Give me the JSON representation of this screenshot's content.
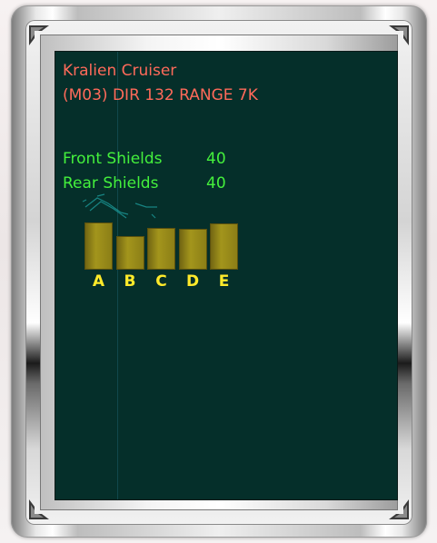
{
  "target": {
    "name": "Kralien Cruiser",
    "info": "(M03) DIR 132 RANGE 7K"
  },
  "shields": {
    "front_label": "Front Shields",
    "front_value": "40",
    "rear_label": "Rear Shields",
    "rear_value": "40"
  },
  "shield_bars": [
    {
      "label": "A",
      "level": 0.82
    },
    {
      "label": "B",
      "level": 0.58
    },
    {
      "label": "C",
      "level": 0.72
    },
    {
      "label": "D",
      "level": 0.7
    },
    {
      "label": "E",
      "level": 0.8
    }
  ],
  "colors": {
    "screen_bg": "#052f2a",
    "target_text": "#ff6a5a",
    "shield_text": "#44f03c",
    "bar_label": "#ffea2a",
    "bar_fill": "#a3951c"
  }
}
